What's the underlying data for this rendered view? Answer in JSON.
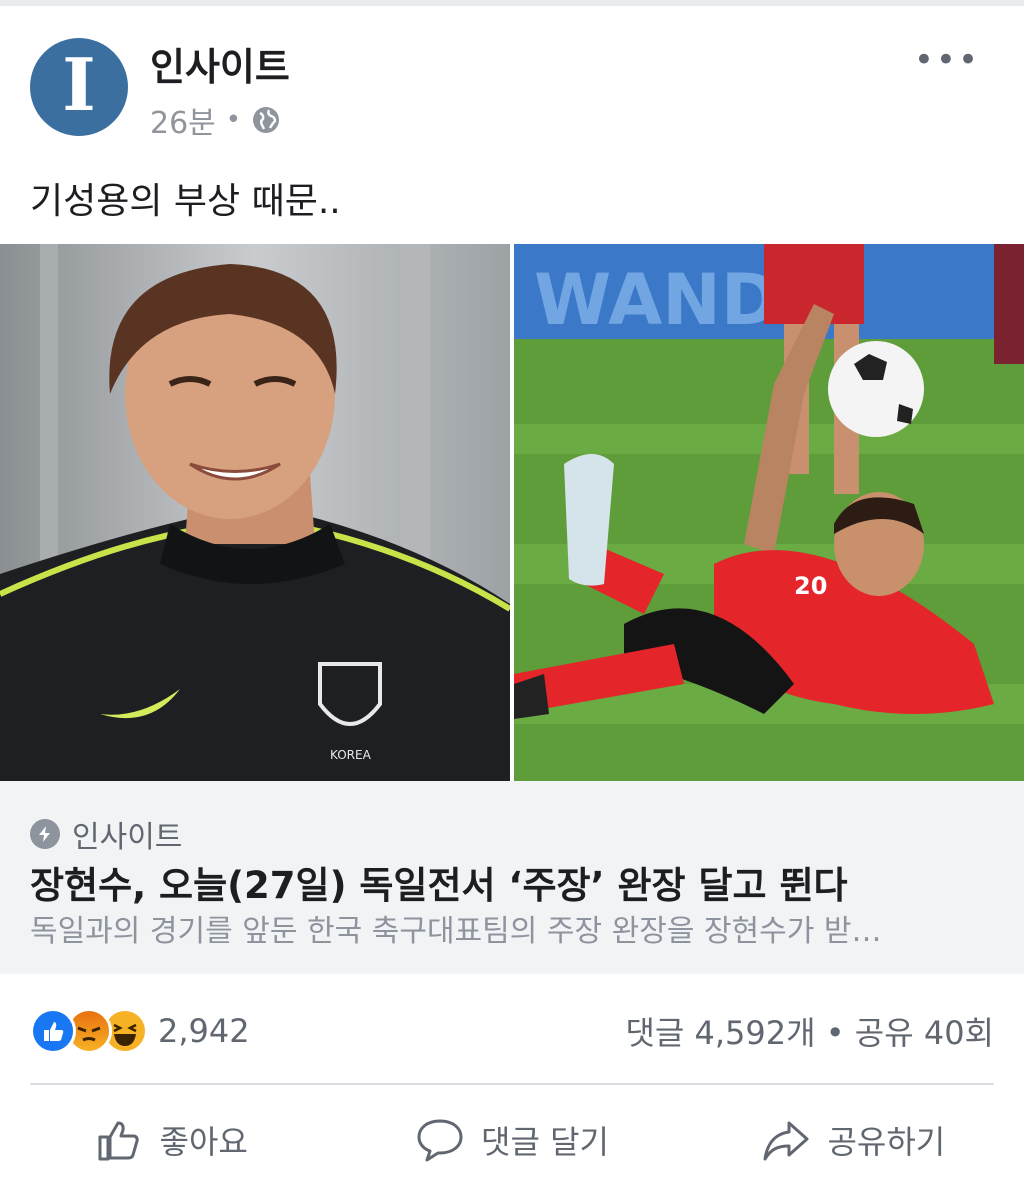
{
  "post": {
    "page_name": "인사이트",
    "avatar_letter": "I",
    "time": "26분",
    "separator": "•",
    "more": "•••",
    "text": "기성용의 부상 때문.."
  },
  "link": {
    "source": "인사이트",
    "headline": "장현수, 오늘(27일) 독일전서 ‘주장’ 완장 달고 뛴다",
    "description": "독일과의 경기를 앞둔 한국 축구대표팀의 주장 완장을 장현수가 받…"
  },
  "engagement": {
    "reactions": [
      "like-icon",
      "angry-icon",
      "haha-icon"
    ],
    "reaction_count": "2,942",
    "stats": "댓글 4,592개 • 공유 40회"
  },
  "actions": {
    "like": "좋아요",
    "comment": "댓글 달기",
    "share": "공유하기"
  },
  "colors": {
    "avatar": "#3b6fa0",
    "like": "#1877f2",
    "angry": "#e9710f",
    "haha": "#f7b125"
  }
}
